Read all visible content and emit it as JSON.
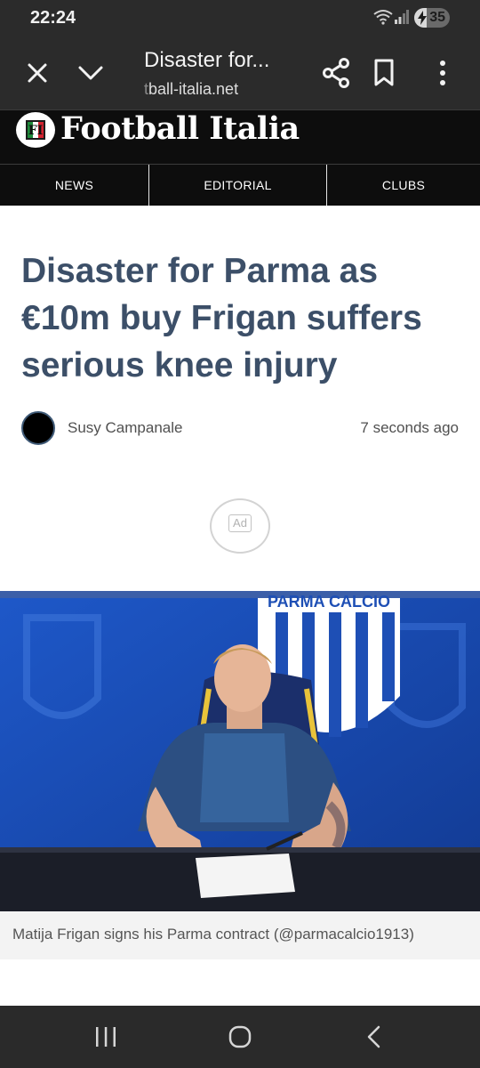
{
  "status_bar": {
    "time": "22:24",
    "battery_level": "35",
    "battery_fraction": 0.35,
    "icons": [
      "wifi-icon",
      "signal-icon",
      "battery-icon"
    ]
  },
  "browser": {
    "page_title": "Disaster for...",
    "url_faded": "t",
    "url_rest": "ball-italia.net",
    "icons": [
      "close-icon",
      "chevron-down-icon",
      "share-icon",
      "bookmark-icon",
      "more-vert-icon"
    ]
  },
  "site": {
    "logo_badge": "FI",
    "logo_text": "Football Italia",
    "nav": [
      "NEWS",
      "EDITORIAL",
      "CLUBS"
    ]
  },
  "article": {
    "headline": "Disaster for Parma as €10m buy Frigan suffers serious knee injury",
    "author": "Susy Campanale",
    "time_ago": "7 seconds ago",
    "ad_label": "Ad",
    "photo_banner_text": "PARMA CALCIO",
    "caption": "Matija Frigan signs his Parma contract (@parmacalcio1913)"
  },
  "system_nav": {
    "icons": [
      "recents-icon",
      "home-icon",
      "back-icon"
    ]
  },
  "colors": {
    "headline": "#3c4f68",
    "chrome_bg": "#2b2b2b",
    "site_header_bg": "#0d0d0d",
    "photo_bg": "#1a4db3"
  }
}
